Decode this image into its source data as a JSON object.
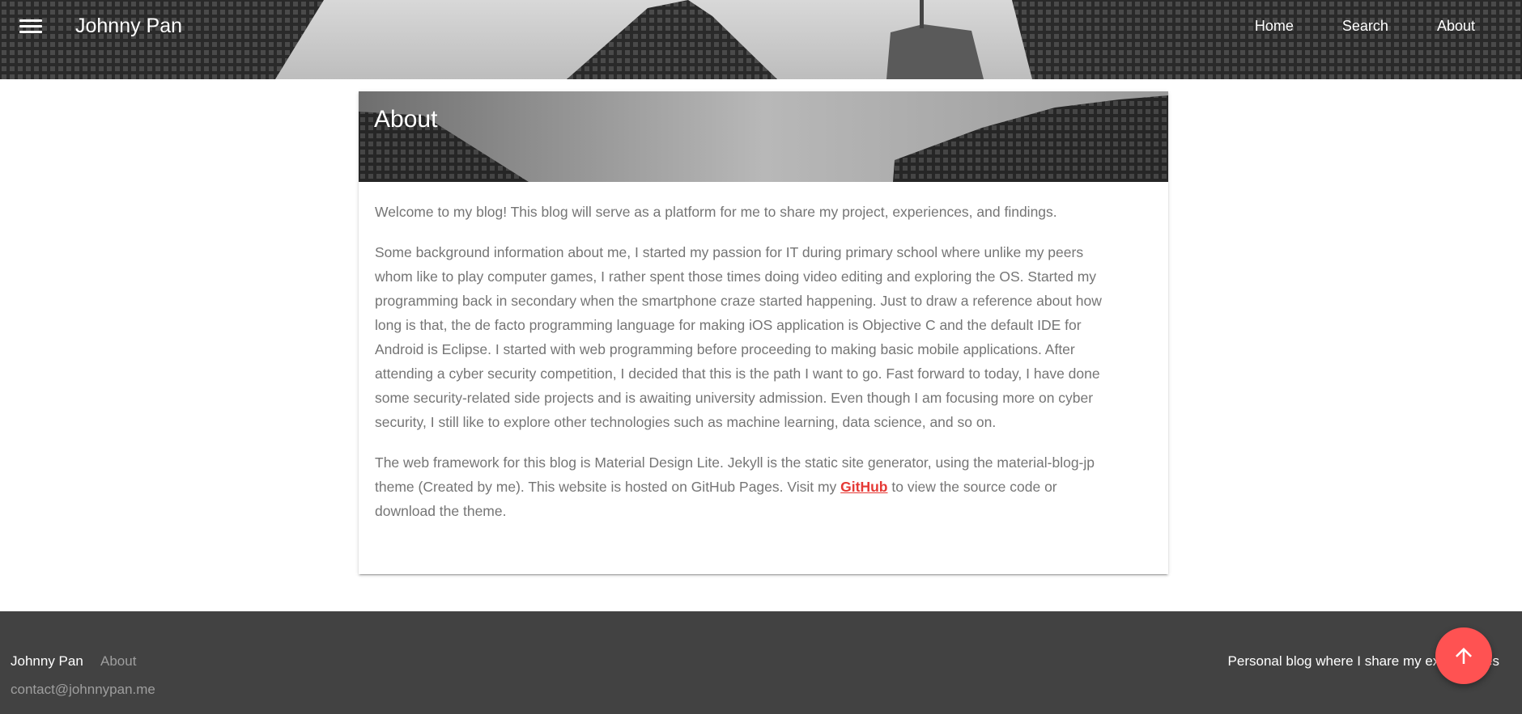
{
  "header": {
    "menu_icon": "menu-icon",
    "site_title": "Johnny Pan",
    "nav": [
      {
        "label": "Home"
      },
      {
        "label": "Search"
      },
      {
        "label": "About"
      }
    ]
  },
  "card": {
    "title": "About",
    "paragraphs": {
      "p1": "Welcome to my blog! This blog will serve as a platform for me to share my project, experiences, and findings.",
      "p2": "Some background information about me, I started my passion for IT during primary school where unlike my peers whom like to play computer games, I rather spent those times doing video editing and exploring the OS. Started my programming back in secondary when the smartphone craze started happening. Just to draw a reference about how long is that, the de facto programming language for making iOS application is Objective C and the default IDE for Android is Eclipse. I started with web programming before proceeding to making basic mobile applications. After attending a cyber security competition, I decided that this is the path I want to go. Fast forward to today, I have done some security-related side projects and is awaiting university admission. Even though I am focusing more on cyber security, I still like to explore other technologies such as machine learning, data science, and so on.",
      "p3_before": "The web framework for this blog is Material Design Lite. Jekyll is the static site generator, using the material-blog-jp theme (Created by me). This website is hosted on GitHub Pages. Visit my ",
      "p3_link": "GitHub",
      "p3_after": " to view the source code or download the theme."
    }
  },
  "footer": {
    "name": "Johnny Pan",
    "about_link": "About",
    "email": "contact@johnnypan.me",
    "tagline": "Personal blog where I share my experiences"
  },
  "fab": {
    "icon": "arrow-up-icon",
    "color": "#ff5252"
  },
  "colors": {
    "accent": "#e53935",
    "footer_bg": "#424242",
    "body_text": "#757575"
  }
}
